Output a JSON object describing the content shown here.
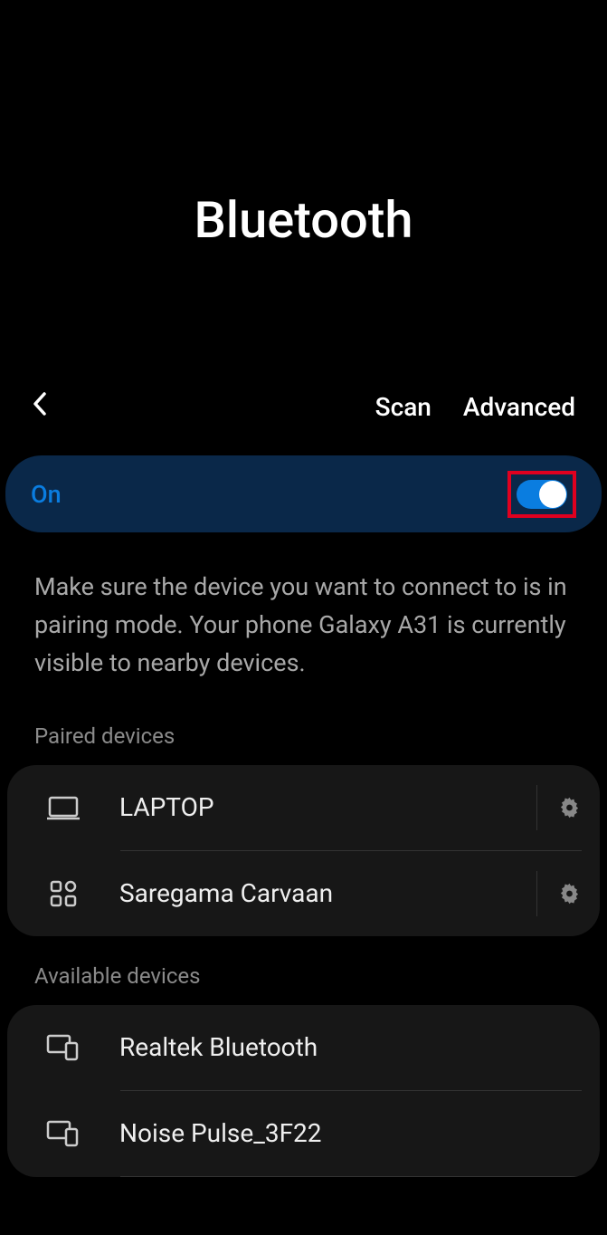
{
  "title": "Bluetooth",
  "actionBar": {
    "scan": "Scan",
    "advanced": "Advanced"
  },
  "toggle": {
    "label": "On",
    "state": true
  },
  "description": "Make sure the device you want to connect to is in pairing mode. Your phone Galaxy A31  is currently visible to nearby devices.",
  "sections": {
    "paired": {
      "header": "Paired devices",
      "devices": [
        {
          "name": "LAPTOP",
          "icon": "laptop"
        },
        {
          "name": "Saregama Carvaan",
          "icon": "grid"
        }
      ]
    },
    "available": {
      "header": "Available devices",
      "devices": [
        {
          "name": "Realtek Bluetooth",
          "icon": "devices"
        },
        {
          "name": "Noise Pulse_3F22",
          "icon": "devices"
        }
      ]
    }
  }
}
